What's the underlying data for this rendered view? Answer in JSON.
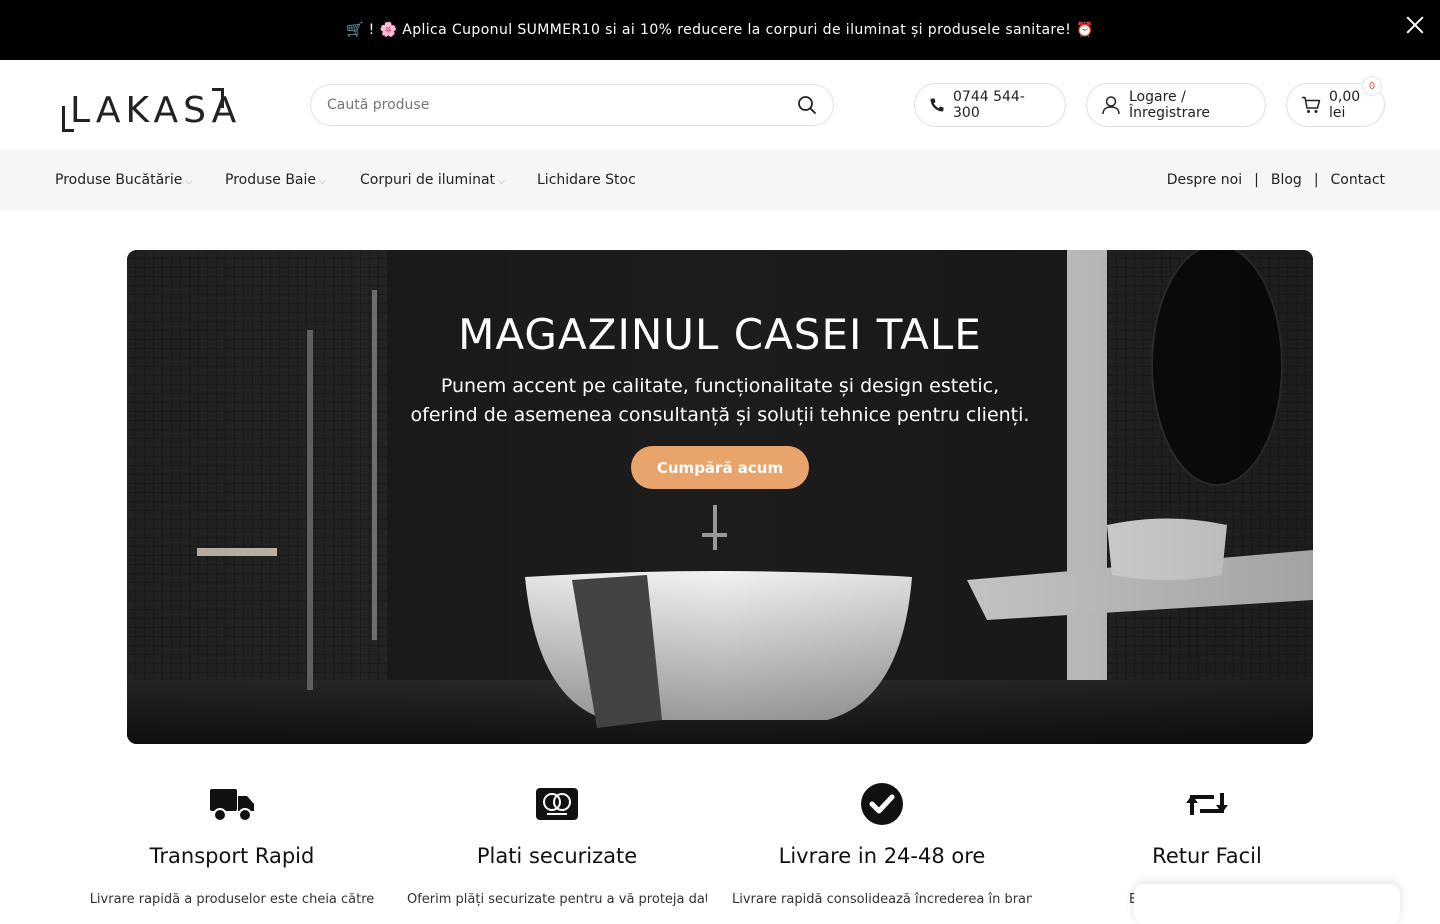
{
  "promo": {
    "text": "🛒 ! 🌸  Aplica Cuponul SUMMER10 si ai 10% reducere la corpuri de iluminat și produsele sanitare! ⏰"
  },
  "header": {
    "logo_text": "LAKASA",
    "search_placeholder": "Caută produse",
    "phone": "0744 544-300",
    "account": "Logare / Înregistrare",
    "cart_total": "0,00 lei",
    "cart_count": "0"
  },
  "nav": {
    "items": [
      {
        "label": "Produse Bucătărie",
        "dropdown": true
      },
      {
        "label": "Produse Baie",
        "dropdown": true
      },
      {
        "label": "Corpuri de iluminat",
        "dropdown": true
      },
      {
        "label": "Lichidare Stoc",
        "dropdown": false
      }
    ],
    "right": [
      "Despre noi",
      "Blog",
      "Contact"
    ],
    "separator": "|"
  },
  "hero": {
    "title": "MAGAZINUL CASEI TALE",
    "subtitle_1": "Punem accent pe calitate, funcționalitate și design estetic,",
    "subtitle_2": "oferind de asemenea consultanță și soluții tehnice pentru clienți.",
    "button": "Cumpără acum"
  },
  "features": [
    {
      "icon": "truck-icon",
      "title": "Transport Rapid",
      "desc": "Livrare rapidă a produselor este cheia către"
    },
    {
      "icon": "mastercard-icon",
      "title": "Plati securizate",
      "desc": "Oferim plăți securizate pentru a vă proteja datele"
    },
    {
      "icon": "check-circle-icon",
      "title": "Livrare in 24-48 ore",
      "desc": "Livrare rapidă consolidează încrederea în brandul"
    },
    {
      "icon": "retweet-icon",
      "title": "Retur Facil",
      "desc": "Beneficiați de retur facil"
    }
  ],
  "colors": {
    "promo_bg": "#000000",
    "nav_bg": "#f5f6f8",
    "hero_button": "#e9a46c",
    "cart_badge": "#e8542f"
  }
}
